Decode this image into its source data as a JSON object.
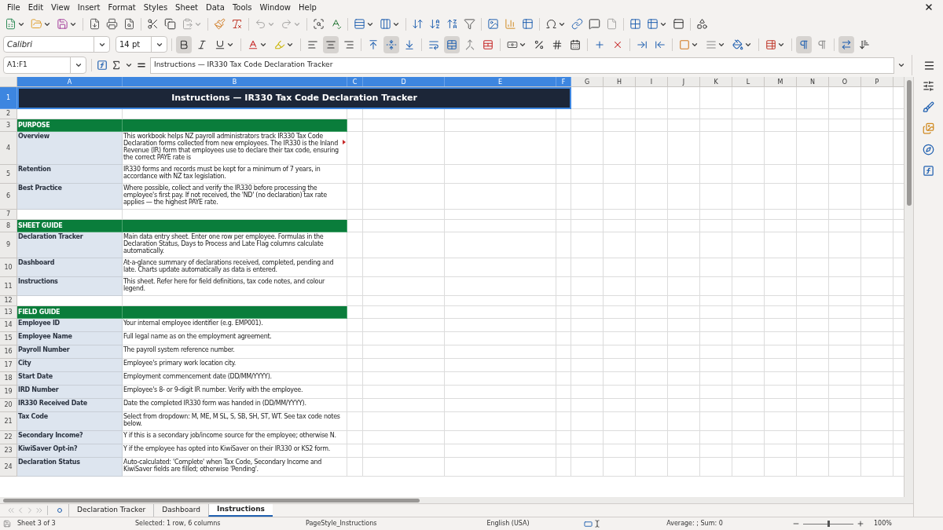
{
  "menu": [
    "File",
    "Edit",
    "View",
    "Insert",
    "Format",
    "Styles",
    "Sheet",
    "Data",
    "Tools",
    "Window",
    "Help"
  ],
  "standard_toolbar": [
    {
      "kind": "new",
      "disabled": false
    },
    {
      "kind": "open",
      "disabled": false
    },
    {
      "kind": "save",
      "disabled": false
    },
    {
      "kind": "pdf",
      "disabled": false
    },
    {
      "kind": "print",
      "disabled": false
    },
    {
      "kind": "preview",
      "disabled": false
    },
    {
      "kind": "cut",
      "disabled": false
    },
    {
      "kind": "copy",
      "disabled": false
    },
    {
      "kind": "paste",
      "disabled": true
    },
    {
      "kind": "clone",
      "disabled": false
    },
    {
      "kind": "clear",
      "disabled": false
    },
    {
      "kind": "undo",
      "disabled": true
    },
    {
      "kind": "redo",
      "disabled": true
    },
    {
      "kind": "find",
      "disabled": false
    },
    {
      "kind": "spelling",
      "disabled": false
    },
    {
      "kind": "row",
      "disabled": false
    },
    {
      "kind": "column",
      "disabled": false
    },
    {
      "kind": "sort",
      "disabled": false
    },
    {
      "kind": "sortasc",
      "disabled": false
    },
    {
      "kind": "sortdesc",
      "disabled": false
    },
    {
      "kind": "filter",
      "disabled": false
    },
    {
      "kind": "image",
      "disabled": false
    },
    {
      "kind": "chart",
      "disabled": false
    },
    {
      "kind": "pivot",
      "disabled": false
    },
    {
      "kind": "special",
      "disabled": false
    },
    {
      "kind": "link",
      "disabled": false
    },
    {
      "kind": "comment",
      "disabled": false
    },
    {
      "kind": "header",
      "disabled": true
    },
    {
      "kind": "printarea",
      "disabled": false
    },
    {
      "kind": "freeze",
      "disabled": false
    },
    {
      "kind": "split",
      "disabled": false
    },
    {
      "kind": "draw",
      "disabled": false
    }
  ],
  "font_name": "Calibri",
  "font_size": "14 pt",
  "format_toolbar": [
    {
      "kind": "bold",
      "active": true
    },
    {
      "kind": "italic",
      "active": false
    },
    {
      "kind": "underline",
      "active": false
    },
    {
      "kind": "fontcolor",
      "active": false
    },
    {
      "kind": "highlight",
      "active": false
    },
    {
      "kind": "left",
      "active": false
    },
    {
      "kind": "center",
      "active": true
    },
    {
      "kind": "right",
      "active": false
    },
    {
      "kind": "top",
      "active": false
    },
    {
      "kind": "middle",
      "active": true
    },
    {
      "kind": "bottom",
      "active": false
    },
    {
      "kind": "wrap",
      "active": false
    },
    {
      "kind": "mergecenter",
      "active": true
    },
    {
      "kind": "merge",
      "active": false
    },
    {
      "kind": "unmerge",
      "active": false
    },
    {
      "kind": "currency",
      "active": false
    },
    {
      "kind": "percent",
      "active": false
    },
    {
      "kind": "number",
      "active": false
    },
    {
      "kind": "date",
      "active": false
    },
    {
      "kind": "adddecimal",
      "active": false
    },
    {
      "kind": "deldecimal",
      "active": false
    },
    {
      "kind": "indent",
      "active": false
    },
    {
      "kind": "outdent",
      "active": false
    },
    {
      "kind": "borders",
      "active": false
    },
    {
      "kind": "borderstyle",
      "active": false
    },
    {
      "kind": "bordercolor",
      "active": false
    },
    {
      "kind": "conditional",
      "active": false
    },
    {
      "kind": "ltr",
      "active": true
    },
    {
      "kind": "rtl",
      "active": false
    },
    {
      "kind": "textdir",
      "active": true
    },
    {
      "kind": "vertical",
      "active": false
    }
  ],
  "name_box": "A1:F1",
  "formula": "Instructions — IR330 Tax Code Declaration Tracker",
  "columns": [
    {
      "label": "A",
      "selected": true
    },
    {
      "label": "B",
      "selected": true
    },
    {
      "label": "C",
      "selected": true
    },
    {
      "label": "D",
      "selected": true
    },
    {
      "label": "E",
      "selected": true
    },
    {
      "label": "F",
      "selected": true
    },
    {
      "label": "G",
      "selected": false
    },
    {
      "label": "H",
      "selected": false
    },
    {
      "label": "I",
      "selected": false
    },
    {
      "label": "J",
      "selected": false
    },
    {
      "label": "K",
      "selected": false
    },
    {
      "label": "L",
      "selected": false
    },
    {
      "label": "M",
      "selected": false
    },
    {
      "label": "N",
      "selected": false
    },
    {
      "label": "O",
      "selected": false
    },
    {
      "label": "P",
      "selected": false
    }
  ],
  "rows": [
    {
      "number": "1",
      "kind": "title",
      "selected": true,
      "text": "Instructions — IR330 Tax Code Declaration Tracker"
    },
    {
      "number": "2",
      "kind": "blank",
      "selected": false
    },
    {
      "number": "3",
      "kind": "section",
      "selected": false,
      "label": "PURPOSE"
    },
    {
      "number": "4",
      "kind": "entry",
      "selected": false,
      "label": "Overview",
      "text": "This workbook helps NZ payroll administrators track IR330 Tax Code Declaration forms collected from new employees. The IR330 is the Inland Revenue (IR) form that employees use to declare their tax code, ensuring the correct PAYE rate is",
      "overflow": true
    },
    {
      "number": "5",
      "kind": "entry",
      "selected": false,
      "label": "Retention",
      "text": "IR330 forms and records must be kept for a minimum of 7 years, in accordance with NZ tax legislation.",
      "overflow": false
    },
    {
      "number": "6",
      "kind": "entry",
      "selected": false,
      "label": "Best Practice",
      "text": "Where possible, collect and verify the IR330 before processing the employee's first pay. If not received, the 'ND' (no declaration) tax rate applies — the highest PAYE rate.",
      "overflow": false
    },
    {
      "number": "7",
      "kind": "blank",
      "selected": false
    },
    {
      "number": "8",
      "kind": "section",
      "selected": false,
      "label": "SHEET GUIDE"
    },
    {
      "number": "9",
      "kind": "entry",
      "selected": false,
      "label": "Declaration Tracker",
      "text": "Main data entry sheet. Enter one row per employee. Formulas in the Declaration Status, Days to Process and Late Flag columns calculate automatically.",
      "overflow": false
    },
    {
      "number": "10",
      "kind": "entry",
      "selected": false,
      "label": "Dashboard",
      "text": "At-a-glance summary of declarations received, completed, pending and late. Charts update automatically as data is entered.",
      "overflow": false
    },
    {
      "number": "11",
      "kind": "entry",
      "selected": false,
      "label": "Instructions",
      "text": "This sheet. Refer here for field definitions, tax code notes, and colour legend.",
      "overflow": false
    },
    {
      "number": "12",
      "kind": "blank",
      "selected": false
    },
    {
      "number": "13",
      "kind": "section",
      "selected": false,
      "label": "FIELD GUIDE"
    },
    {
      "number": "14",
      "kind": "entry",
      "selected": false,
      "label": "Employee ID",
      "text": "Your internal employee identifier (e.g. EMP001).",
      "overflow": false
    },
    {
      "number": "15",
      "kind": "entry",
      "selected": false,
      "label": "Employee Name",
      "text": "Full legal name as on the employment agreement.",
      "overflow": false
    },
    {
      "number": "16",
      "kind": "entry",
      "selected": false,
      "label": "Payroll Number",
      "text": "The payroll system reference number.",
      "overflow": false
    },
    {
      "number": "17",
      "kind": "entry",
      "selected": false,
      "label": "City",
      "text": "Employee's primary work location city.",
      "overflow": false
    },
    {
      "number": "18",
      "kind": "entry",
      "selected": false,
      "label": "Start Date",
      "text": "Employment commencement date (DD/MM/YYYY).",
      "overflow": false
    },
    {
      "number": "19",
      "kind": "entry",
      "selected": false,
      "label": "IRD Number",
      "text": "Employee's 8- or 9-digit IR number. Verify with the employee.",
      "overflow": false
    },
    {
      "number": "20",
      "kind": "entry",
      "selected": false,
      "label": "IR330 Received Date",
      "text": "Date the completed IR330 form was handed in (DD/MM/YYYY).",
      "overflow": false
    },
    {
      "number": "21",
      "kind": "entry",
      "selected": false,
      "label": "Tax Code",
      "text": "Select from dropdown: M, ME, M SL, S, SB, SH, ST, WT. See tax code notes below.",
      "overflow": false
    },
    {
      "number": "22",
      "kind": "entry",
      "selected": false,
      "label": "Secondary Income?",
      "text": "Y if this is a secondary job/income source for the employee; otherwise N.",
      "overflow": false
    },
    {
      "number": "23",
      "kind": "entry",
      "selected": false,
      "label": "KiwiSaver Opt-in?",
      "text": "Y if the employee has opted into KiwiSaver on their IR330 or KS2 form.",
      "overflow": false
    },
    {
      "number": "24",
      "kind": "entry",
      "selected": false,
      "label": "Declaration Status",
      "text": "Auto-calculated: 'Complete' when Tax Code, Secondary Income and KiwiSaver fields are filled; otherwise 'Pending'.",
      "overflow": false
    }
  ],
  "sheet_tabs": [
    {
      "label": "Declaration Tracker",
      "selected": false
    },
    {
      "label": "Dashboard",
      "selected": false
    },
    {
      "label": "Instructions",
      "selected": true
    }
  ],
  "status_bar": {
    "sheet": "Sheet 3 of 3",
    "selection": "Selected: 1 row, 6 columns",
    "page_style": "PageStyle_Instructions",
    "language": "English (USA)",
    "summary": "Average: ; Sum: 0",
    "zoom": "100%",
    "zoom_slider": {
      "level": 0.5
    }
  }
}
